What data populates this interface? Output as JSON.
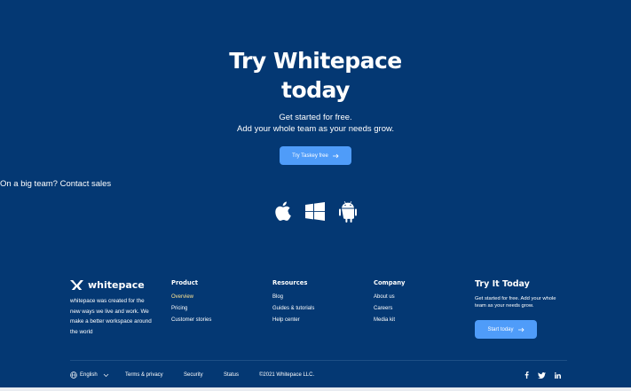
{
  "hero": {
    "title_line1": "Try Whitepace",
    "title_line2": "today",
    "subtitle_line1": "Get started for free.",
    "subtitle_line2": "Add your whole team as your needs grow.",
    "cta_label": "Try Taskey free",
    "contact_text": "On a big team? Contact sales",
    "platform_icons": [
      "apple-icon",
      "windows-icon",
      "android-icon"
    ]
  },
  "footer": {
    "brand_name": "whitepace",
    "description": "whitepace was created for the new ways we live and work. We make a better workspace around the world",
    "columns": [
      {
        "title": "Product",
        "links": [
          "Overview",
          "Pricing",
          "Customer stories"
        ]
      },
      {
        "title": "Resources",
        "links": [
          "Blog",
          "Guides & tutorials",
          "Help center"
        ]
      },
      {
        "title": "Company",
        "links": [
          "About us",
          "Careers",
          "Media kit"
        ]
      }
    ],
    "try": {
      "title": "Try It Today",
      "text": "Get started for free. Add your whole team as your needs grow.",
      "button_label": "Start today"
    },
    "bottom": {
      "language": "English",
      "terms": "Terms & privacy",
      "security": "Security",
      "status": "Status",
      "copyright": "©2021 Whitepace LLC."
    },
    "social_icons": [
      "facebook-icon",
      "twitter-icon",
      "linkedin-icon"
    ]
  },
  "colors": {
    "background": "#043873",
    "accent": "#4f9cf9",
    "active_link": "#ffe492"
  }
}
